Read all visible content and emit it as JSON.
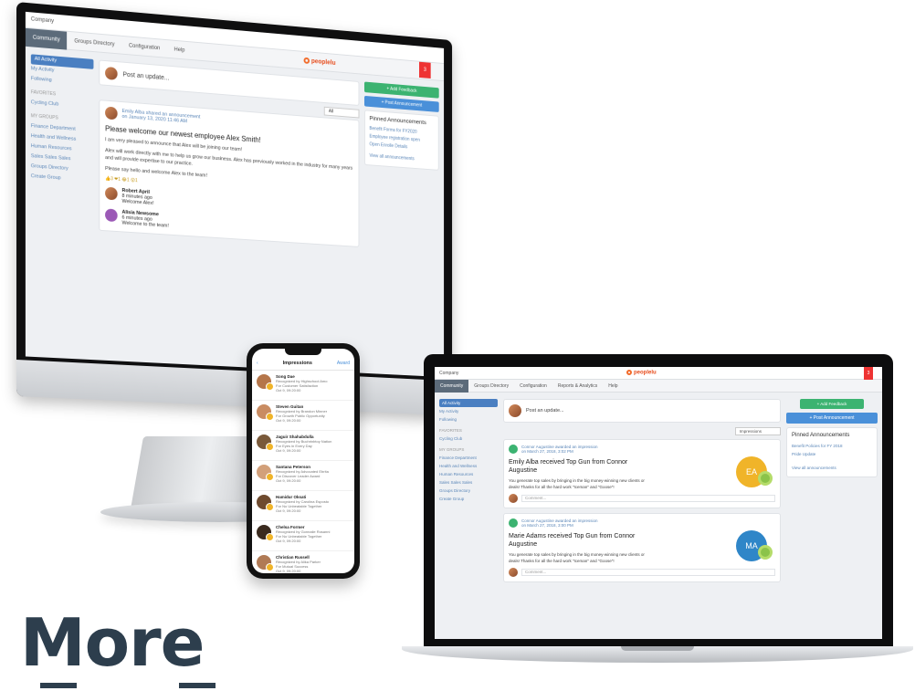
{
  "monitor": {
    "topbar": "Company",
    "nav_tabs": [
      "Community",
      "Groups Directory",
      "Configuration",
      "Help"
    ],
    "brand": "peoplelu",
    "notif_count": "3",
    "sidebar": {
      "items_top": [
        "All Activity",
        "My Activity",
        "Following"
      ],
      "favorites_header": "FAVORITES",
      "favorites": [
        "Cycling Club"
      ],
      "groups_header": "MY GROUPS",
      "groups": [
        "Finance Department",
        "Health and Wellness",
        "Human Resources",
        "Sales Sales Sales",
        "Groups Directory",
        "Create Group"
      ]
    },
    "post_placeholder": "Post an update...",
    "filter": "All",
    "post": {
      "author_line": "Emily Alba shared an announcement",
      "date": "on January 13, 2020 11:46 AM",
      "title": "Please welcome our newest employee Alex Smith!",
      "p1": "I am very pleased to announce that Alex will be joining our team!",
      "p2": "Alex will work directly with me to help us grow our business. Alex has previously worked in the industry for many years and will provide expertise to our practice.",
      "p3": "Please say hello and welcome Alex to the team!",
      "reactions": "👍3 ❤1 😂1 😮1",
      "comment1_name": "Robert April",
      "comment1_time": "8 minutes ago",
      "comment1_text": "Welcome Alex!",
      "comment2_name": "Alisia Newsome",
      "comment2_time": "6 minutes ago",
      "comment2_text": "Welcome to the team!"
    },
    "right": {
      "green_button": "+ Add Feedback",
      "blue_button": "+ Post Announcement",
      "pinned_title": "Pinned Announcements",
      "pinned_links": [
        "Benefit Forms for FY2020",
        "Employee registration open",
        "Open Enrolle Details"
      ],
      "view_all": "View all announcements"
    }
  },
  "laptop": {
    "topbar": "Company",
    "nav_tabs": [
      "Community",
      "Groups Directory",
      "Configuration",
      "Reports & Analytics",
      "Help"
    ],
    "brand": "peoplelu",
    "notif_count": "3",
    "sidebar": {
      "items_top": [
        "All Activity",
        "My Activity",
        "Following"
      ],
      "favorites_header": "FAVORITES",
      "favorites": [
        "Cycling Club"
      ],
      "groups_header": "MY GROUPS",
      "groups": [
        "Finance Department",
        "Health and Wellness",
        "Human Resources",
        "Sales Sales Sales",
        "Groups Directory",
        "Create Group"
      ]
    },
    "post_placeholder": "Post an update...",
    "filter": "Impressions",
    "posts": [
      {
        "author_line": "Connor Augustine awarded an impression",
        "date": "on March 27, 2018, 3:02 PM",
        "title": "Emily Alba received Top Gun from Connor Augustine",
        "text": "You generate top sales by bringing in the big money-winning new clients or deals! Thanks for all the hard work \"Iceman\" and \"Goose\"!",
        "initials": "EA",
        "comment_placeholder": "Comment..."
      },
      {
        "author_line": "Connor Augustine awarded an impression",
        "date": "on March 27, 2018, 3:00 PM",
        "title": "Marie Adams received Top Gun from Connor Augustine",
        "text": "You generate top sales by bringing in the big money-winning new clients or deals! Thanks for all the hard work \"Iceman\" and \"Goose\"!",
        "initials": "MA",
        "comment_placeholder": "Comment..."
      }
    ],
    "right": {
      "green_button": "+ Add Feedback",
      "blue_button": "+ Post Announcement",
      "pinned_title": "Pinned Announcements",
      "pinned_links": [
        "Benefit Policies for FY 2018",
        "Pride Update"
      ],
      "view_all": "View all announcements"
    }
  },
  "phone": {
    "back": "‹",
    "title": "Impressions",
    "action": "Award",
    "items": [
      {
        "name": "Song Dae",
        "line1": "Recognized by Highschool Amo",
        "line2": "For Customer Satisfaction",
        "date": "Oct 9, 09:20:00",
        "color": "#b5764a"
      },
      {
        "name": "Steven Guitan",
        "line1": "Recognized by Brandon Minner",
        "line2": "For Growth Public Opportunity",
        "date": "Oct 9, 09:20:00",
        "color": "#c98c62"
      },
      {
        "name": "Jaguir Shahabdulla",
        "line1": "Recognized by Buchrinbtoy Nation",
        "line2": "For Eyes in Every Day",
        "date": "Oct 9, 09:20:00",
        "color": "#7a5a3a"
      },
      {
        "name": "Santana Peterson",
        "line1": "Recognized by Advocated Ebrita",
        "line2": "For Discover Leader Award",
        "date": "Oct 9, 09:20:00",
        "color": "#d2a07a"
      },
      {
        "name": "Hamidur Oksati",
        "line1": "Recognized by Carolina Esposto",
        "line2": "For No Unbeatable Together",
        "date": "Oct 9, 09:20:00",
        "color": "#6e4a2e"
      },
      {
        "name": "Chelsa Former",
        "line1": "Recognized by Gonnalie Rosanni",
        "line2": "For No Unbeatable Together",
        "date": "Oct 9, 09:20:00",
        "color": "#3a2a1e"
      },
      {
        "name": "Christian Russell",
        "line1": "Recognized by Alika Parker",
        "line2": "For Mutual Success",
        "date": "Oct 9, 09:20:00",
        "color": "#b07a55"
      }
    ]
  },
  "headline": "More"
}
